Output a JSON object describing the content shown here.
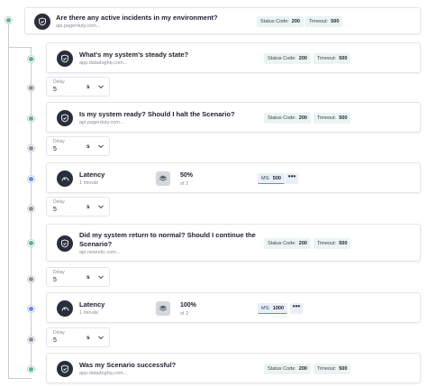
{
  "colors": {
    "accent_green": "#52b788",
    "accent_blue": "#5b8def",
    "pill_bg": "#eaf4f1"
  },
  "steps": [
    {
      "type": "probe",
      "title": "Are there any active incidents in my environment?",
      "source": "api.pagerduty.com...",
      "status_code_label": "Status Code:",
      "status_code": "200",
      "timeout_label": "Timeout:",
      "timeout": "500",
      "icon": "shield-check-icon"
    },
    {
      "type": "probe",
      "title": "What's my system's steady state?",
      "source": "app.datadoghq.com...",
      "status_code_label": "Status Code:",
      "status_code": "200",
      "timeout_label": "Timeout:",
      "timeout": "500",
      "icon": "shield-check-icon"
    },
    {
      "type": "probe",
      "title": "Is my system ready? Should I halt the Scenario?",
      "source": "api.pagerduty.com...",
      "status_code_label": "Status Code:",
      "status_code": "200",
      "timeout_label": "Timeout:",
      "timeout": "500",
      "icon": "shield-check-icon"
    },
    {
      "type": "attack",
      "title": "Latency",
      "duration": "1 minute",
      "percent": "50%",
      "of": "of 2",
      "ms_label": "MS:",
      "ms": "500",
      "icon": "gauge-icon"
    },
    {
      "type": "probe",
      "title_line1": "Did my system return to normal? Should I continue the",
      "title_line2": "Scenario?",
      "source": "api.newrelic.com...",
      "status_code_label": "Status Code:",
      "status_code": "200",
      "timeout_label": "Timeout:",
      "timeout": "500",
      "icon": "shield-check-icon"
    },
    {
      "type": "attack",
      "title": "Latency",
      "duration": "1 minute",
      "percent": "100%",
      "of": "of 2",
      "ms_label": "MS:",
      "ms": "1000",
      "icon": "gauge-icon"
    },
    {
      "type": "probe",
      "title": "Was my Scenario successful?",
      "source": "app.datadoghq.com...",
      "status_code_label": "Status Code:",
      "status_code": "200",
      "timeout_label": "Timeout:",
      "timeout": "500",
      "icon": "shield-check-icon"
    }
  ],
  "delays": [
    {
      "label": "Delay",
      "value": "5",
      "unit": "s"
    },
    {
      "label": "Delay",
      "value": "5",
      "unit": "s"
    },
    {
      "label": "Delay",
      "value": "5",
      "unit": "s"
    },
    {
      "label": "Delay",
      "value": "5",
      "unit": "s"
    },
    {
      "label": "Delay",
      "value": "5",
      "unit": "s"
    }
  ],
  "more_label": "•••"
}
